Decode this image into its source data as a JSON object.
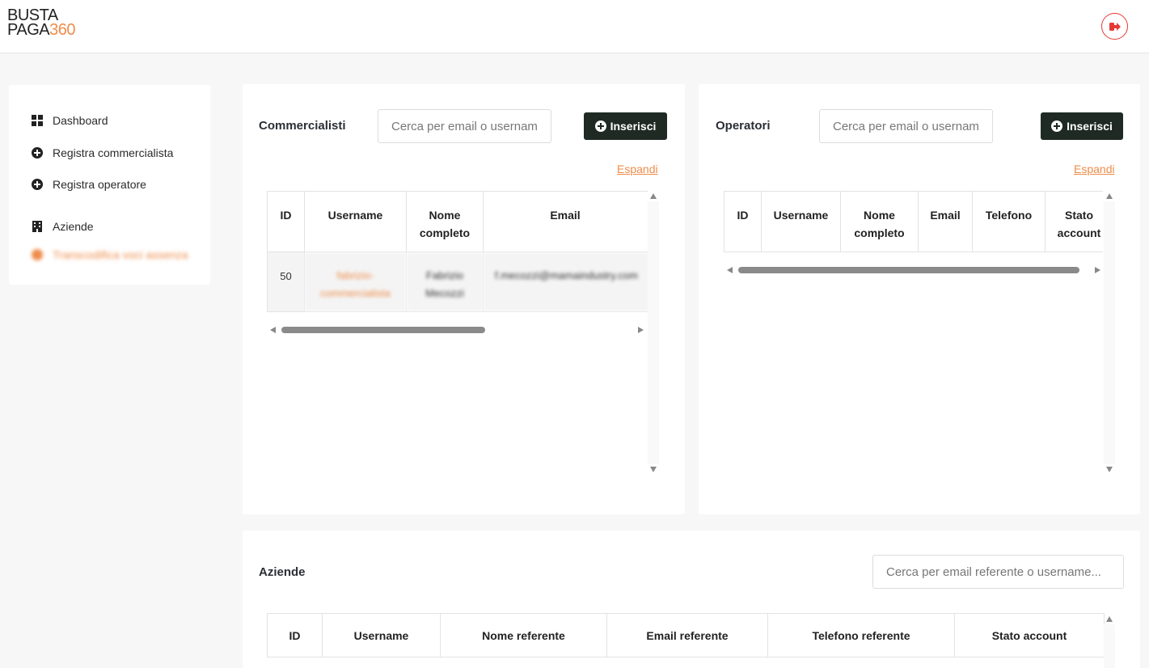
{
  "brand": {
    "line1": "BUSTA",
    "line2": "PAGA",
    "accent": "360"
  },
  "colors": {
    "accent": "#ee8c4a",
    "button_dark": "#1f2a24",
    "logout_red": "#e53935"
  },
  "sidebar": {
    "items": [
      {
        "label": "Dashboard",
        "icon": "grid-icon"
      },
      {
        "label": "Registra commercialista",
        "icon": "plus-circle-icon"
      },
      {
        "label": "Registra operatore",
        "icon": "plus-circle-icon"
      },
      {
        "label": "Aziende",
        "icon": "building-icon"
      },
      {
        "label": "Transcodifica voci assenza",
        "icon": "dot-icon"
      }
    ]
  },
  "commercialisti": {
    "title": "Commercialisti",
    "search_placeholder": "Cerca per email o username",
    "insert_label": "Inserisci",
    "expand_label": "Espandi",
    "columns": [
      "ID",
      "Username",
      "Nome completo",
      "Email"
    ],
    "rows": [
      {
        "id": "50",
        "username": "fabrizio-commercialista",
        "name": "Fabrizio Mecozzi",
        "email": "f.mecozzi@mamaindustry.com"
      }
    ]
  },
  "operatori": {
    "title": "Operatori",
    "search_placeholder": "Cerca per email o username",
    "insert_label": "Inserisci",
    "expand_label": "Espandi",
    "columns": [
      "ID",
      "Username",
      "Nome completo",
      "Email",
      "Telefono",
      "Stato account"
    ]
  },
  "aziende": {
    "title": "Aziende",
    "search_placeholder": "Cerca per email referente o username...",
    "columns": [
      "ID",
      "Username",
      "Nome referente",
      "Email referente",
      "Telefono referente",
      "Stato account"
    ]
  }
}
